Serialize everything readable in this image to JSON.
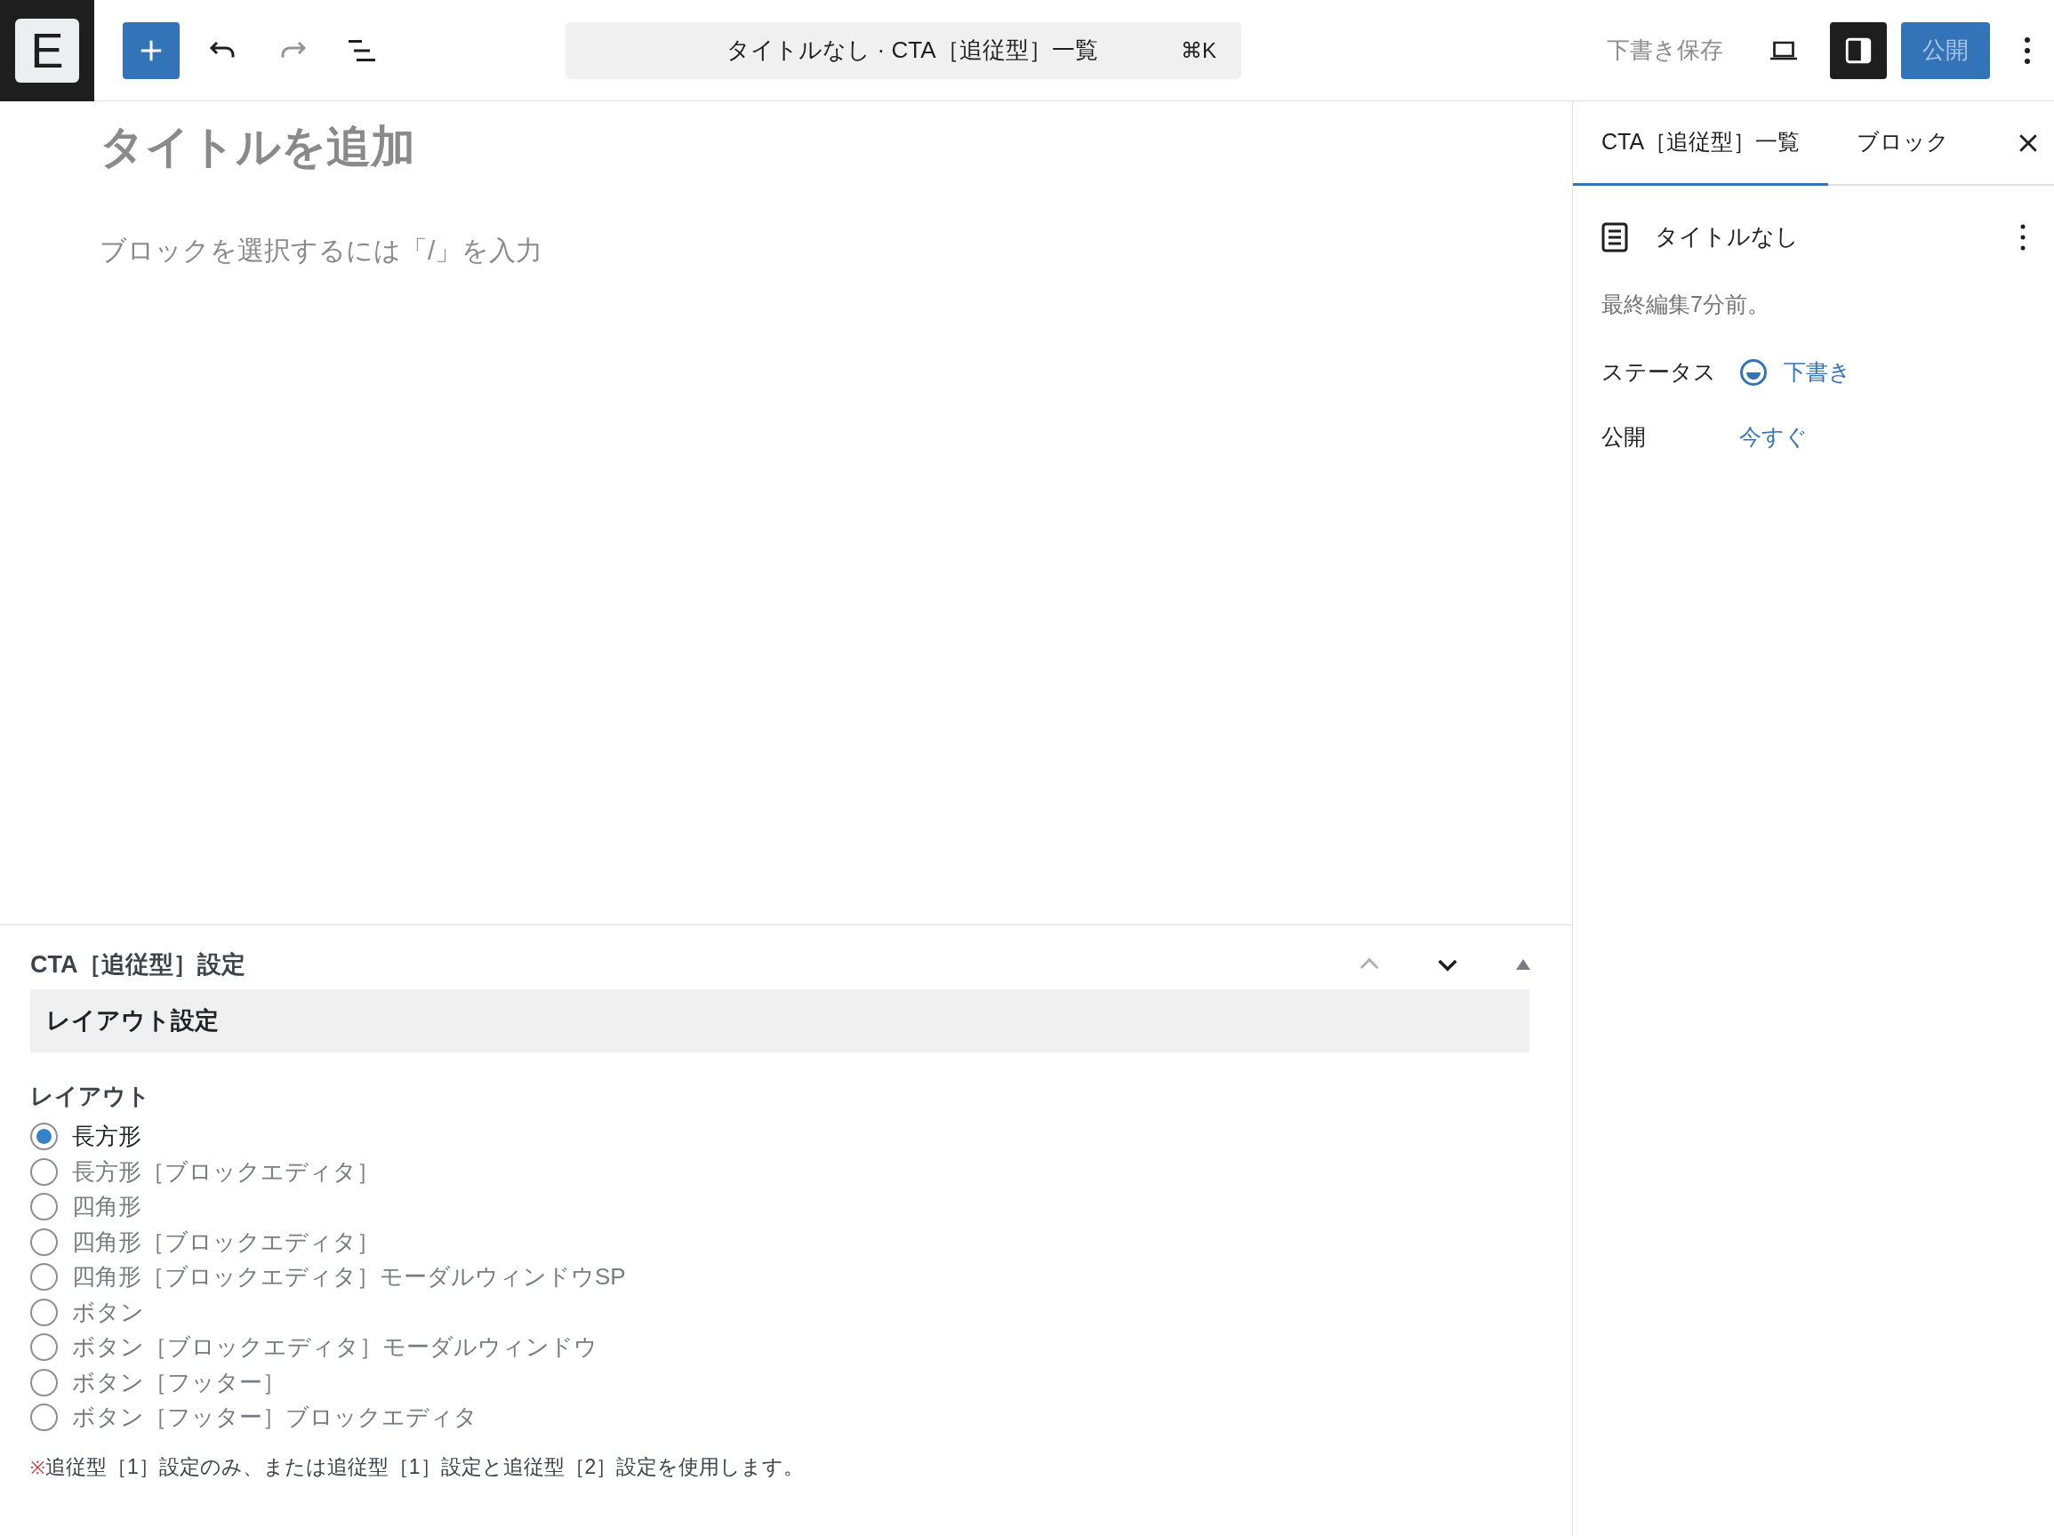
{
  "toolbar": {
    "logo": "E",
    "command_bar": {
      "title": "タイトルなし · CTA［追従型］一覧",
      "shortcut": "⌘K"
    },
    "save_draft": "下書き保存",
    "publish": "公開"
  },
  "editor": {
    "title_placeholder": "タイトルを追加",
    "block_placeholder": "ブロックを選択するには「/」を入力"
  },
  "meta_box": {
    "title": "CTA［追従型］設定",
    "section": "レイアウト設定",
    "field_label": "レイアウト",
    "options": [
      {
        "label": "長方形",
        "selected": true
      },
      {
        "label": "長方形［ブロックエディタ］",
        "selected": false
      },
      {
        "label": "四角形",
        "selected": false
      },
      {
        "label": "四角形［ブロックエディタ］",
        "selected": false
      },
      {
        "label": "四角形［ブロックエディタ］モーダルウィンドウSP",
        "selected": false
      },
      {
        "label": "ボタン",
        "selected": false
      },
      {
        "label": "ボタン［ブロックエディタ］モーダルウィンドウ",
        "selected": false
      },
      {
        "label": "ボタン［フッター］",
        "selected": false
      },
      {
        "label": "ボタン［フッター］ブロックエディタ",
        "selected": false
      }
    ],
    "note_mark": "※",
    "note": "追従型［1］設定のみ、または追従型［1］設定と追従型［2］設定を使用します。"
  },
  "sidebar": {
    "tabs": [
      {
        "label": "CTA［追従型］一覧",
        "selected": true
      },
      {
        "label": "ブロック",
        "selected": false
      }
    ],
    "post_title": "タイトルなし",
    "last_edited": "最終編集7分前。",
    "rows": [
      {
        "label": "ステータス",
        "value": "下書き",
        "kind": "status"
      },
      {
        "label": "公開",
        "value": "今すぐ",
        "kind": "plain"
      }
    ]
  }
}
